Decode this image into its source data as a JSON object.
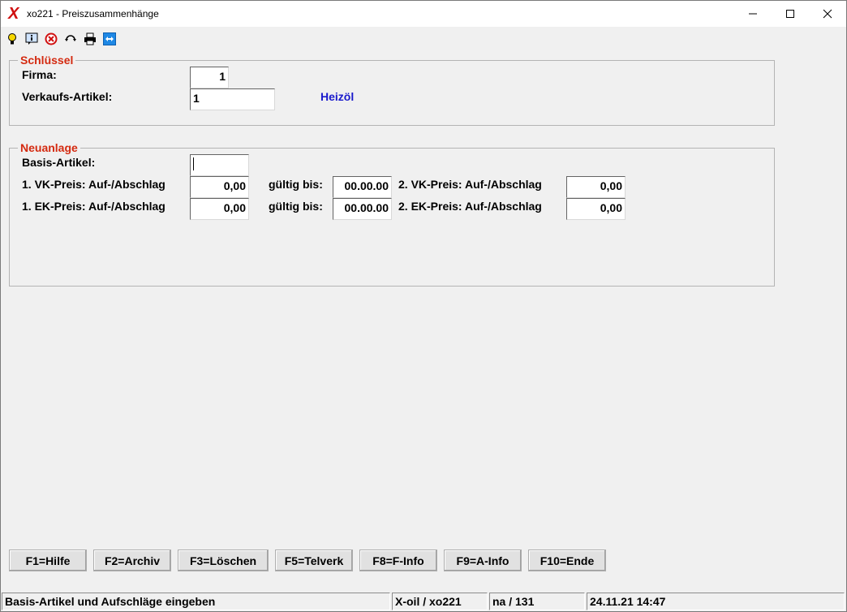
{
  "window": {
    "app_icon_glyph": "X",
    "title": "xo221 - Preiszusammenhänge"
  },
  "toolbar": {
    "icons": [
      "lightbulb-icon",
      "info-icon",
      "cancel-icon",
      "refresh-icon",
      "printer-icon",
      "teamviewer-icon"
    ]
  },
  "schluessel": {
    "title": "Schlüssel",
    "firma_label": "Firma:",
    "firma_value": "1",
    "artikel_label": "Verkaufs-Artikel:",
    "artikel_value": "1",
    "artikel_name": "Heizöl"
  },
  "neuanlage": {
    "title": "Neuanlage",
    "basis_label": "Basis-Artikel:",
    "basis_value": "",
    "vk1_label": "1. VK-Preis: Auf-/Abschlag",
    "vk1_value": "0,00",
    "vk_gueltig_label": "gültig bis:",
    "vk_gueltig_value": "00.00.00",
    "vk2_label": "2. VK-Preis: Auf-/Abschlag",
    "vk2_value": "0,00",
    "ek1_label": "1. EK-Preis: Auf-/Abschlag",
    "ek1_value": "0,00",
    "ek_gueltig_label": "gültig bis:",
    "ek_gueltig_value": "00.00.00",
    "ek2_label": "2. EK-Preis: Auf-/Abschlag",
    "ek2_value": "0,00"
  },
  "function_keys": {
    "f1": "F1=Hilfe",
    "f2": "F2=Archiv",
    "f3": "F3=Löschen",
    "f5": "F5=Telverk",
    "f8": "F8=F-Info",
    "f9": "F9=A-Info",
    "f10": "F10=Ende"
  },
  "statusbar": {
    "message": "Basis-Artikel und Aufschläge eingeben",
    "system": "X-oil / xo221",
    "user": "na / 131",
    "datetime": "24.11.21 14:47"
  },
  "colors": {
    "group_title": "#d42a10",
    "article_name": "#1a1acc",
    "app_icon": "#d01010"
  }
}
